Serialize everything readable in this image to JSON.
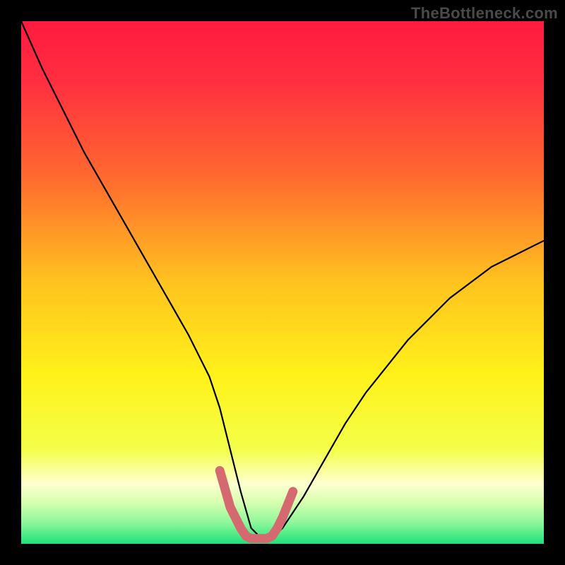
{
  "watermark": "TheBottleneck.com",
  "chart_data": {
    "type": "line",
    "title": "",
    "xlabel": "",
    "ylabel": "",
    "xlim": [
      0,
      100
    ],
    "ylim": [
      0,
      100
    ],
    "background_gradient_stops": [
      {
        "offset": 0,
        "color": "#ff1a3f"
      },
      {
        "offset": 0.12,
        "color": "#ff3040"
      },
      {
        "offset": 0.3,
        "color": "#ff6a2f"
      },
      {
        "offset": 0.5,
        "color": "#ffc31f"
      },
      {
        "offset": 0.68,
        "color": "#fff21a"
      },
      {
        "offset": 0.82,
        "color": "#f3ff4a"
      },
      {
        "offset": 0.885,
        "color": "#feffd0"
      },
      {
        "offset": 0.92,
        "color": "#d8ffb0"
      },
      {
        "offset": 0.96,
        "color": "#8cf79a"
      },
      {
        "offset": 1.0,
        "color": "#1fe07a"
      }
    ],
    "series": [
      {
        "name": "bottleneck-curve",
        "stroke": "#000000",
        "stroke_width": 2.2,
        "x": [
          0,
          4,
          8,
          12,
          16,
          20,
          24,
          28,
          32,
          36,
          38,
          40,
          42,
          44,
          46,
          48,
          50,
          54,
          58,
          62,
          66,
          70,
          74,
          78,
          82,
          86,
          90,
          94,
          98,
          100
        ],
        "y": [
          100,
          91,
          83,
          75,
          68,
          61,
          54,
          47,
          40,
          32,
          26,
          18,
          10,
          3,
          1,
          1,
          3,
          9,
          16,
          23,
          29,
          34,
          39,
          43,
          47,
          50,
          53,
          55,
          57,
          58
        ]
      },
      {
        "name": "valley-highlight",
        "stroke": "#d46a6f",
        "stroke_width": 13,
        "linecap": "round",
        "x": [
          38,
          40,
          42,
          43,
          44,
          45,
          46,
          47,
          48,
          49,
          50,
          52
        ],
        "y": [
          14,
          7,
          3,
          1.5,
          1,
          1,
          1,
          1,
          1.5,
          3,
          5,
          10
        ]
      }
    ]
  }
}
